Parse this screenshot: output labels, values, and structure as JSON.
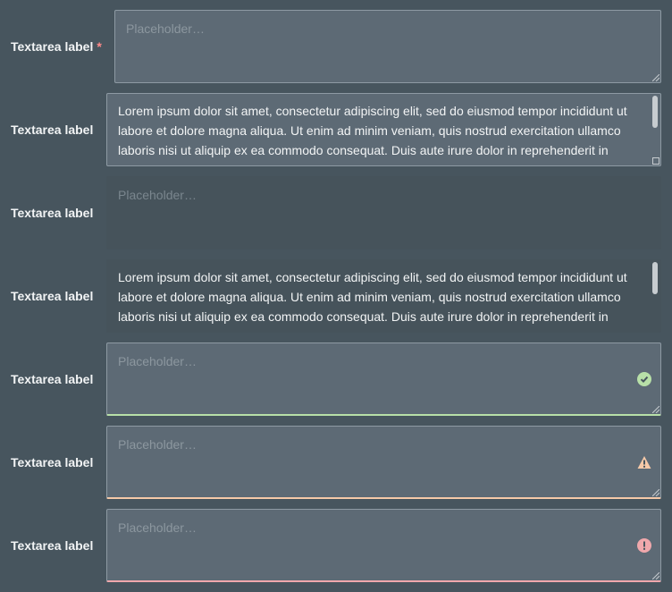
{
  "fields": [
    {
      "label": "Textarea label",
      "required_mark": "*",
      "placeholder": "Placeholder…"
    },
    {
      "label": "Textarea label",
      "value": "Lorem ipsum dolor sit amet, consectetur adipiscing elit, sed do eiusmod tempor incididunt ut labore et dolore magna aliqua. Ut enim ad minim veniam, quis nostrud exercitation ullamco laboris nisi ut aliquip ex ea commodo consequat. Duis aute irure dolor in reprehenderit in voluptate velit esse cillum dolore eu fugiat nulla pariatur. Excepteur sint occaecat cupidatat non proident."
    },
    {
      "label": "Textarea label",
      "placeholder": "Placeholder…",
      "state": "disabled"
    },
    {
      "label": "Textarea label",
      "value": "Lorem ipsum dolor sit amet, consectetur adipiscing elit, sed do eiusmod tempor incididunt ut labore et dolore magna aliqua. Ut enim ad minim veniam, quis nostrud exercitation ullamco laboris nisi ut aliquip ex ea commodo consequat. Duis aute irure dolor in reprehenderit in voluptate velit esse cillum dolore eu fugiat nulla pariatur. Excepteur sint occaecat cupidatat non proident.",
      "state": "readonly"
    },
    {
      "label": "Textarea label",
      "placeholder": "Placeholder…",
      "state": "success",
      "icon": "check-circle-icon",
      "color": "#b8e0a8"
    },
    {
      "label": "Textarea label",
      "placeholder": "Placeholder…",
      "state": "warning",
      "icon": "warning-triangle-icon",
      "color": "#f5c9a8"
    },
    {
      "label": "Textarea label",
      "placeholder": "Placeholder…",
      "state": "error",
      "icon": "error-circle-icon",
      "color": "#f0a8ac"
    }
  ]
}
